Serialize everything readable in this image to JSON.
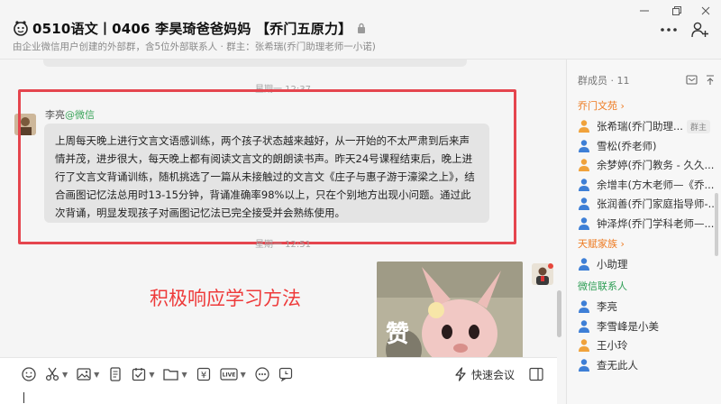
{
  "header": {
    "title": "0510语文丨0406  李昊琦爸爸妈妈 【乔门五原力】",
    "subtitle": "由企业微信用户创建的外部群，含5位外部联系人 · 群主：张希瑞(乔门助理老师一小诺)"
  },
  "chat": {
    "time_1": "星期一 12:37",
    "sender_name": "李亮",
    "sender_tag": "@微信",
    "message": "上周每天晚上进行文言文语感训练，两个孩子状态越来越好，从一开始的不太严肃到后来声情并茂，进步很大，每天晚上都有阅读文言文的朗朗读书声。昨天24号课程结束后，晚上进行了文言文背诵训练，随机挑选了一篇从未接触过的文言文《庄子与惠子游于濠梁之上》，结合画图记忆法总用时13-15分钟，背诵准确率98%以上，只在个别地方出现小问题。通过此次背诵，明显发现孩子对画图记忆法已完全接受并会熟练使用。",
    "time_2": "星期一 12:51",
    "annotation": "积极响应学习方法",
    "sticker_text": "赞"
  },
  "composer": {
    "meeting_label": "快速会议",
    "live_label": "LIVE",
    "yen_label": "¥"
  },
  "members": {
    "header": "群成员 · 11",
    "sections": [
      {
        "label": "乔门文苑 ›",
        "items": [
          {
            "name": "张希瑞(乔门助理...",
            "badge": "群主"
          },
          {
            "name": "雪松(乔老师)"
          },
          {
            "name": "余梦婷(乔门教务 - 久久..."
          },
          {
            "name": "余增丰(方木老师—《乔..."
          },
          {
            "name": "张润善(乔门家庭指导师-..."
          },
          {
            "name": "钟泽烨(乔门学科老师—..."
          }
        ]
      },
      {
        "label": "天赋家族 ›",
        "items": [
          {
            "name": "小助理"
          }
        ]
      },
      {
        "label": "微信联系人",
        "items": [
          {
            "name": "李亮"
          },
          {
            "name": "李雪峰是小美"
          },
          {
            "name": "王小玲"
          },
          {
            "name": "查无此人"
          }
        ]
      }
    ]
  },
  "colors": {
    "highlight_border": "#e5454e",
    "annotation_text": "#ee3a3a",
    "section_orange": "#ee7b22",
    "section_green": "#2e9e55",
    "wechat_tag": "#3aa55a"
  }
}
